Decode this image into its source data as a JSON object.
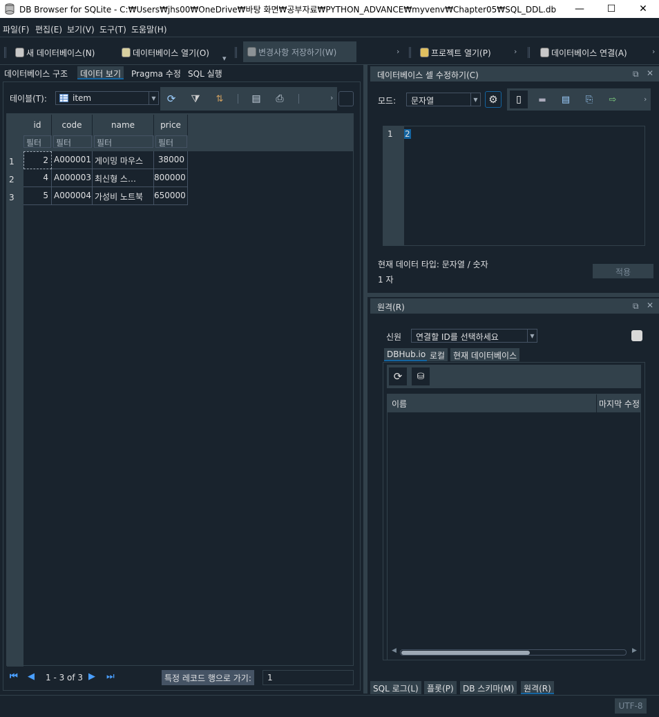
{
  "window": {
    "title": "DB Browser for SQLite - C:₩Users₩jhs00₩OneDrive₩바탕 화면₩공부자료₩PYTHON_ADVANCE₩myvenv₩Chapter05₩SQL_DDL.db",
    "minimize": "—",
    "maximize": "☐",
    "close": "✕"
  },
  "menu": [
    "파일(F)",
    "편집(E)",
    "보기(V)",
    "도구(T)",
    "도움말(H)"
  ],
  "toolbar": {
    "new_db": "새 데이터베이스(N)",
    "open_db": "데이터베이스 열기(O)",
    "write_changes": "변경사항 저장하기(W)",
    "open_project": "프로젝트 열기(P)",
    "attach_db": "데이터베이스 연결(A)"
  },
  "left_tabs": [
    "데이터베이스 구조",
    "데이터 보기",
    "Pragma 수정",
    "SQL 실행"
  ],
  "browse": {
    "table_label": "테이블(T):",
    "table_value": "item",
    "columns": [
      "id",
      "code",
      "name",
      "price"
    ],
    "filter_placeholder": "필터",
    "rows": [
      {
        "rownum": "1",
        "id": "2",
        "code": "A000001",
        "name": "게이밍 마우스",
        "price": "38000"
      },
      {
        "rownum": "2",
        "id": "4",
        "code": "A000003",
        "name": "최신형 스…",
        "price": "800000"
      },
      {
        "rownum": "3",
        "id": "5",
        "code": "A000004",
        "name": "가성비 노트북",
        "price": "650000"
      }
    ],
    "nav_status": "1 - 3 of 3",
    "goto_label": "특정 레코드 행으로 가기:",
    "goto_value": "1"
  },
  "edit_cell": {
    "title": "데이터베이스 셀 수정하기(C)",
    "mode_label": "모드:",
    "mode_value": "문자열",
    "line_number": "1",
    "content": "2",
    "type_info": "현재 데이터 타입: 문자열 / 숫자",
    "size_info": "1 자",
    "apply_label": "적용"
  },
  "remote": {
    "title": "원격(R)",
    "identity_label": "신원",
    "identity_value": "연결할 ID를 선택하세요",
    "tabs": [
      "DBHub.io",
      "로컬",
      "현재 데이터베이스"
    ],
    "col_name": "이름",
    "col_modified": "마지막 수정"
  },
  "bottom_tabs": [
    "SQL 로그(L)",
    "플롯(P)",
    "DB 스키마(M)",
    "원격(R)"
  ],
  "status": {
    "encoding": "UTF-8"
  }
}
